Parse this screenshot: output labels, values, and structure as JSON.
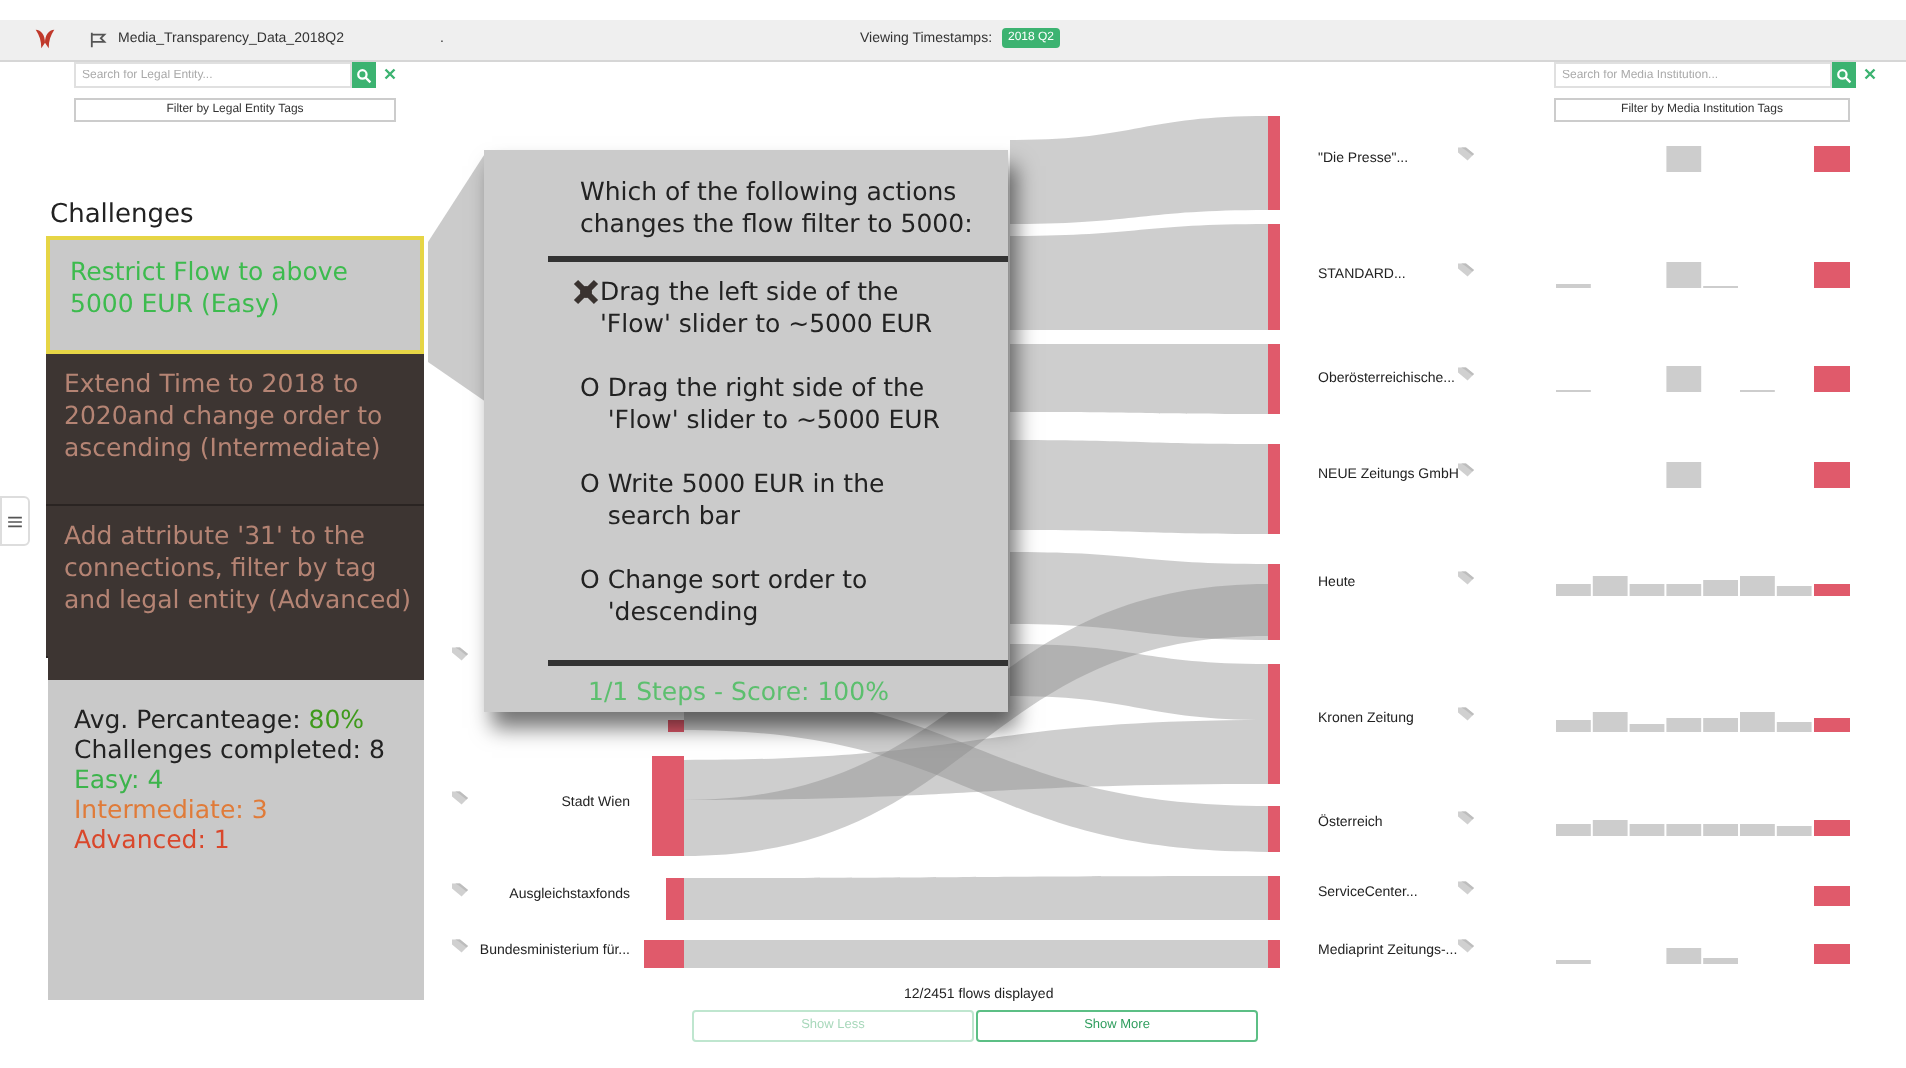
{
  "header": {
    "file_name": "Media_Transparency_Data_2018Q2",
    "separator": ".",
    "timestamps_label": "Viewing Timestamps:",
    "timestamp": "2018 Q2"
  },
  "left_filter": {
    "placeholder": "Search for Legal Entity...",
    "tags_button": "Filter by Legal Entity Tags"
  },
  "right_filter": {
    "placeholder": "Search for Media Institution...",
    "tags_button": "Filter by Media Institution Tags"
  },
  "legal_entities": [
    {
      "name": "Stadt Wien"
    },
    {
      "name": "Ausgleichstaxfonds"
    },
    {
      "name": "Bundesministerium für..."
    }
  ],
  "media": [
    {
      "name": "\"Die Presse\"..."
    },
    {
      "name": "STANDARD..."
    },
    {
      "name": "Oberösterreichische..."
    },
    {
      "name": "NEUE Zeitungs GmbH"
    },
    {
      "name": "Heute"
    },
    {
      "name": "Kronen Zeitung"
    },
    {
      "name": "Österreich"
    },
    {
      "name": "ServiceCenter..."
    },
    {
      "name": "Mediaprint Zeitungs-..."
    }
  ],
  "flows_status": "12/2451 flows displayed",
  "buttons": [
    {
      "label": "Show Less",
      "disabled": true
    },
    {
      "label": "Show More",
      "disabled": false
    }
  ],
  "challenges": {
    "title": "Challenges",
    "items": [
      {
        "text": "Restrict Flow to above 5000 EUR (Easy)",
        "selected": true
      },
      {
        "text": "Extend Time to 2018 to 2020and change order to ascending (Intermediate)",
        "selected": false
      },
      {
        "text": "Add attribute '31' to the connections, filter by tag and legal entity (Advanced)",
        "selected": false
      }
    ],
    "stats": {
      "avg_label": "Avg. Percanteage:",
      "avg_value": "80%",
      "completed": "Challenges completed: 8",
      "easy": "Easy: 4",
      "intermediate": "Intermediate: 3",
      "advanced": "Advanced: 1"
    }
  },
  "quiz": {
    "question": "Which of the following actions changes the flow filter to 5000:",
    "options": [
      {
        "text": "Drag the left side of the 'Flow' slider to ~5000 EUR",
        "checked": true
      },
      {
        "text": "Drag the right side of the 'Flow' slider to ~5000 EUR",
        "checked": false,
        "marker": "O"
      },
      {
        "text": "Write 5000 EUR in the search bar",
        "checked": false,
        "marker": "O"
      },
      {
        "text": "Change sort order to 'descending",
        "checked": false,
        "marker": "O"
      }
    ],
    "score": "1/1 Steps - Score: 100%"
  }
}
